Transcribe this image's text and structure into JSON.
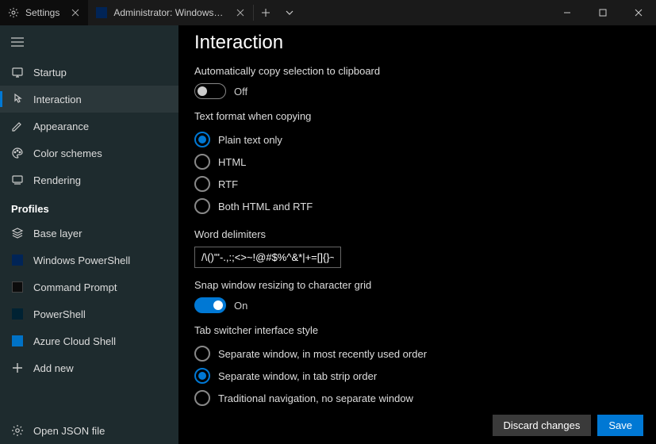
{
  "tabs": [
    {
      "label": "Settings",
      "active": true
    },
    {
      "label": "Administrator: Windows PowerS",
      "active": false
    }
  ],
  "sidebar": {
    "items": [
      {
        "label": "Startup"
      },
      {
        "label": "Interaction"
      },
      {
        "label": "Appearance"
      },
      {
        "label": "Color schemes"
      },
      {
        "label": "Rendering"
      }
    ],
    "profiles_header": "Profiles",
    "profiles": [
      {
        "label": "Base layer"
      },
      {
        "label": "Windows PowerShell"
      },
      {
        "label": "Command Prompt"
      },
      {
        "label": "PowerShell"
      },
      {
        "label": "Azure Cloud Shell"
      },
      {
        "label": "Add new"
      }
    ],
    "footer": {
      "label": "Open JSON file"
    }
  },
  "page": {
    "title": "Interaction",
    "auto_copy": {
      "label": "Automatically copy selection to clipboard",
      "state_text": "Off",
      "on": false
    },
    "text_format": {
      "label": "Text format when copying",
      "options": [
        {
          "label": "Plain text only",
          "checked": true
        },
        {
          "label": "HTML",
          "checked": false
        },
        {
          "label": "RTF",
          "checked": false
        },
        {
          "label": "Both HTML and RTF",
          "checked": false
        }
      ]
    },
    "word_delimiters": {
      "label": "Word delimiters",
      "value": "/\\()\"'-.,:;<>~!@#$%^&*|+=[]{}~?|"
    },
    "snap": {
      "label": "Snap window resizing to character grid",
      "state_text": "On",
      "on": true
    },
    "tab_switcher": {
      "label": "Tab switcher interface style",
      "options": [
        {
          "label": "Separate window, in most recently used order",
          "checked": false
        },
        {
          "label": "Separate window, in tab strip order",
          "checked": true
        },
        {
          "label": "Traditional navigation, no separate window",
          "checked": false
        }
      ]
    }
  },
  "footer": {
    "discard": "Discard changes",
    "save": "Save"
  }
}
